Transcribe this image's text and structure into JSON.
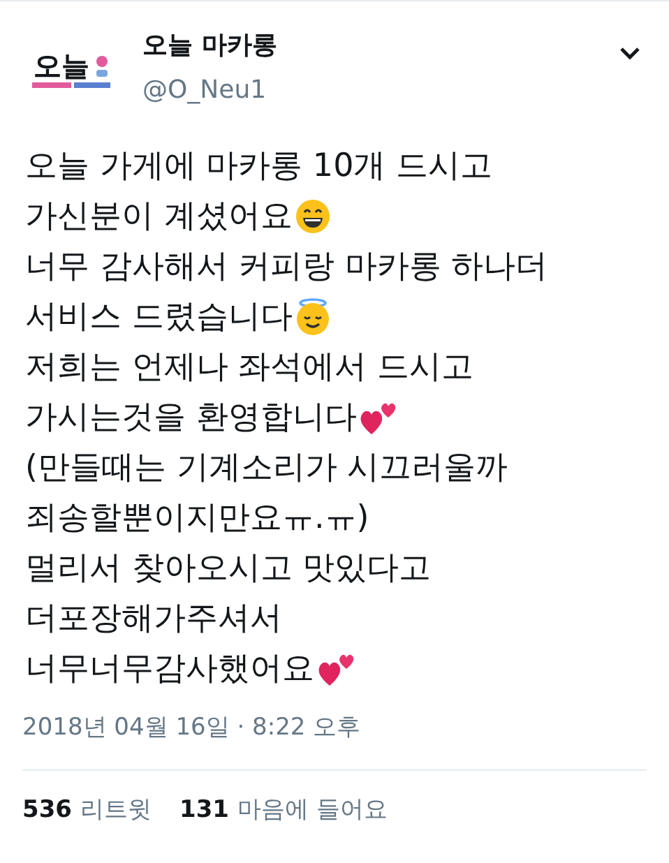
{
  "tweet": {
    "avatar": {
      "logo_text": "오늘"
    },
    "name": "오늘 마카롱",
    "handle": "@O_Neu1",
    "lines": [
      {
        "text": "오늘 가게에 마카롱 10개 드시고"
      },
      {
        "text": "가신분이 계셨어요",
        "kind": "grin"
      },
      {
        "text": "너무 감사해서 커피랑 마카롱 하나더"
      },
      {
        "text": "서비스 드렸습니다",
        "kind": "halo"
      },
      {
        "text": "저희는 언제나 좌석에서 드시고"
      },
      {
        "text": "가시는것을 환영합니다",
        "kind": "hearts"
      },
      {
        "text": "(만들때는 기계소리가 시끄러울까"
      },
      {
        "text": "죄송할뿐이지만요ㅠ.ㅠ)"
      },
      {
        "text": "멀리서 찾아오시고 맛있다고"
      },
      {
        "text": "더포장해가주셔서"
      },
      {
        "text": "너무너무감사했어요",
        "kind": "hearts"
      }
    ],
    "timestamp": "2018년 04월 16일 · 8:22 오후",
    "stats": [
      {
        "count": "536",
        "label": "리트윗"
      },
      {
        "count": "131",
        "label": "마음에 들어요"
      }
    ]
  }
}
